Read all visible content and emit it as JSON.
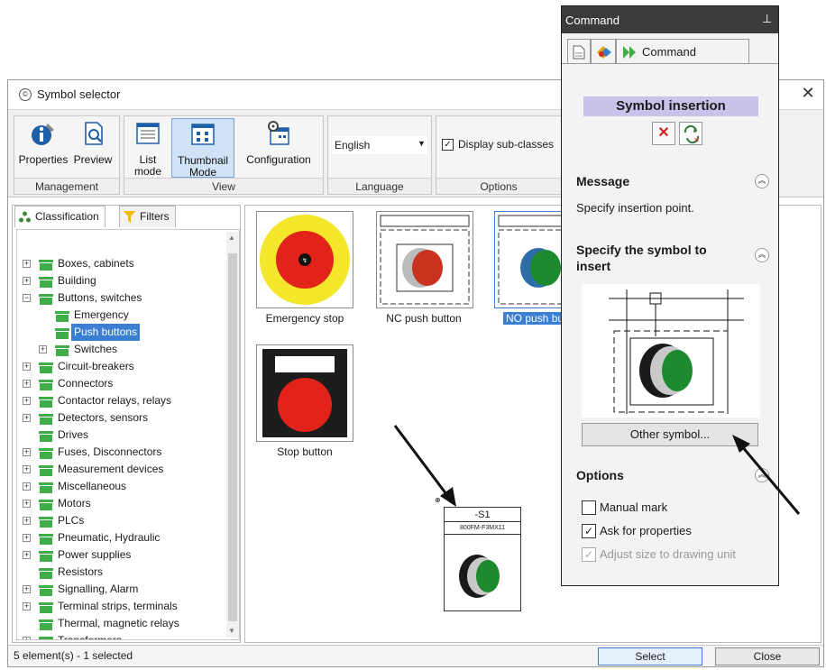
{
  "window": {
    "title": "Symbol selector",
    "close_glyph": "✕"
  },
  "ribbon": {
    "groups": {
      "management": "Management",
      "view": "View",
      "language": "Language",
      "options": "Options"
    },
    "buttons": {
      "properties": "Properties",
      "preview": "Preview",
      "list_mode_1": "List",
      "list_mode_2": "mode",
      "thumbnail_mode_1": "Thumbnail",
      "thumbnail_mode_2": "Mode",
      "configuration": "Configuration"
    },
    "language_value": "English",
    "display_subclasses": "Display sub-classes"
  },
  "left_panel": {
    "tabs": [
      "Classification",
      "Filters"
    ],
    "tree": [
      {
        "label": "Boxes, cabinets",
        "level": 0,
        "expandable": true
      },
      {
        "label": "Building",
        "level": 0,
        "expandable": true
      },
      {
        "label": "Buttons, switches",
        "level": 0,
        "expandable": true,
        "expanded": true
      },
      {
        "label": "Emergency",
        "level": 1,
        "expandable": false
      },
      {
        "label": "Push buttons",
        "level": 1,
        "expandable": false,
        "selected": true
      },
      {
        "label": "Switches",
        "level": 1,
        "expandable": true
      },
      {
        "label": "Circuit-breakers",
        "level": 0,
        "expandable": true
      },
      {
        "label": "Connectors",
        "level": 0,
        "expandable": true
      },
      {
        "label": "Contactor relays, relays",
        "level": 0,
        "expandable": true
      },
      {
        "label": "Detectors, sensors",
        "level": 0,
        "expandable": true
      },
      {
        "label": "Drives",
        "level": 0,
        "expandable": false
      },
      {
        "label": "Fuses, Disconnectors",
        "level": 0,
        "expandable": true
      },
      {
        "label": "Measurement devices",
        "level": 0,
        "expandable": true
      },
      {
        "label": "Miscellaneous",
        "level": 0,
        "expandable": true
      },
      {
        "label": "Motors",
        "level": 0,
        "expandable": true
      },
      {
        "label": "PLCs",
        "level": 0,
        "expandable": true
      },
      {
        "label": "Pneumatic, Hydraulic",
        "level": 0,
        "expandable": true
      },
      {
        "label": "Power supplies",
        "level": 0,
        "expandable": true
      },
      {
        "label": "Resistors",
        "level": 0,
        "expandable": false
      },
      {
        "label": "Signalling, Alarm",
        "level": 0,
        "expandable": true
      },
      {
        "label": "Terminal strips, terminals",
        "level": 0,
        "expandable": true
      },
      {
        "label": "Thermal, magnetic relays",
        "level": 0,
        "expandable": false
      },
      {
        "label": "Transformers",
        "level": 0,
        "expandable": true
      }
    ]
  },
  "thumbnails": {
    "emergency_stop": "Emergency stop",
    "nc_push_button": "NC push button",
    "no_push_button": "NO push bu",
    "stop_button": "Stop button"
  },
  "placed_symbol": {
    "mark": "-S1",
    "reference": "800FM-F3MX11"
  },
  "status": {
    "text": "5 element(s) - 1 selected",
    "select_label": "Select",
    "close_label": "Close"
  },
  "command_panel": {
    "title": "Command",
    "pin_glyph": "⊥",
    "tab_label": "Command",
    "section_title": "Symbol insertion",
    "message_header": "Message",
    "message_text": "Specify insertion point.",
    "specify_header_1": "Specify the symbol to",
    "specify_header_2": "insert",
    "other_symbol_label": "Other symbol...",
    "options_header": "Options",
    "manual_mark": "Manual mark",
    "ask_properties": "Ask for properties",
    "adjust_size": "Adjust size to drawing unit"
  },
  "colors": {
    "accent": "#3a7fd2",
    "command_header": "#3b3b3b",
    "section_title_bg": "#c8c3ea",
    "button_green": "#1e8a2e",
    "button_red": "#e2231a",
    "emergency_yellow": "#f3e62b",
    "folder_green": "#3fae49"
  }
}
